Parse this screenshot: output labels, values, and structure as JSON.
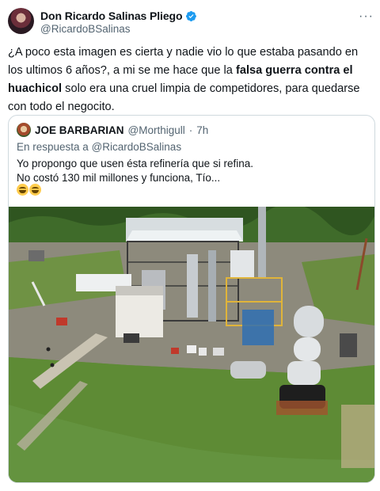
{
  "tweet": {
    "display_name": "Don Ricardo Salinas Pliego",
    "handle": "@RicardoBSalinas",
    "more_label": "···",
    "text_before": "¿A poco esta imagen es cierta y nadie vio lo que estaba pasando en los ultimos 6 años?, a mi se me hace que la ",
    "text_bold": "falsa guerra contra el huachicol",
    "text_after": " solo era una cruel limpia de competidores, para quedarse con todo el negocito."
  },
  "quote": {
    "display_name": "JOE BARBARIAN",
    "handle": "@Morthigull",
    "separator": "·",
    "time": "7h",
    "reply_prefix": "En respuesta a ",
    "reply_mention": "@RicardoBSalinas",
    "line1": "Yo propongo que usen ésta refinería que si refina.",
    "line2": "No costó 130 mil millones y funciona, Tío...",
    "emoji_count": 2
  },
  "colors": {
    "verified": "#1d9bf0",
    "secondary_text": "#536471",
    "border": "#cfd9de"
  },
  "icons": [
    "verified-badge-icon",
    "more-options-icon",
    "laughing-emoji-icon"
  ]
}
